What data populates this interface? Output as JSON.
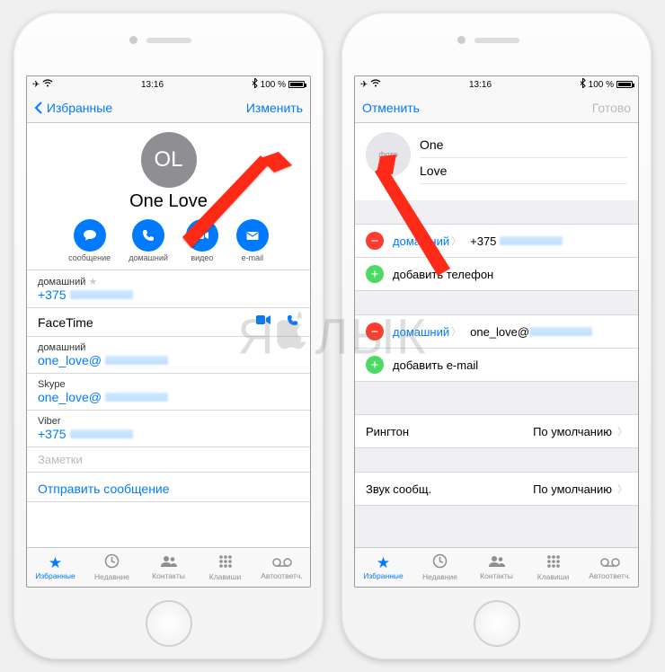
{
  "status": {
    "time": "13:16",
    "battery": "100 %",
    "bt_icon": "bt",
    "wifi_icon": "wifi",
    "plane_icon": "plane"
  },
  "left": {
    "nav": {
      "back": "Избранные",
      "edit": "Изменить"
    },
    "contact": {
      "initials": "OL",
      "name": "One Love"
    },
    "actions": [
      {
        "key": "message",
        "label": "сообщение",
        "icon": "message"
      },
      {
        "key": "home",
        "label": "домашний",
        "icon": "call"
      },
      {
        "key": "video",
        "label": "видео",
        "icon": "video"
      },
      {
        "key": "email",
        "label": "e-mail",
        "icon": "mail"
      }
    ],
    "rows": {
      "home_label": "домашний",
      "home_value": "+375",
      "facetime_label": "FaceTime",
      "email_label": "домашний",
      "email_value": "one_love@",
      "skype_label": "Skype",
      "skype_value": "one_love@",
      "viber_label": "Viber",
      "viber_value": "+375",
      "notes_label": "Заметки",
      "send_message": "Отправить сообщение"
    }
  },
  "right": {
    "nav": {
      "cancel": "Отменить",
      "done": "Готово"
    },
    "photo_label": "фото",
    "first_name": "One",
    "last_name": "Love",
    "phone": {
      "field_label": "домашний",
      "value": "+375",
      "add_label": "добавить телефон"
    },
    "email": {
      "field_label": "домашний",
      "value": "one_love@",
      "add_label": "добавить e-mail"
    },
    "ringtone": {
      "label": "Рингтон",
      "value": "По умолчанию"
    },
    "textTone": {
      "label": "Звук сообщ.",
      "value": "По умолчанию"
    }
  },
  "tabs": [
    {
      "key": "fav",
      "label": "Избранные",
      "icon": "★"
    },
    {
      "key": "recent",
      "label": "Недавние",
      "icon": "clock"
    },
    {
      "key": "contacts",
      "label": "Контакты",
      "icon": "people"
    },
    {
      "key": "keypad",
      "label": "Клавиши",
      "icon": "keypad"
    },
    {
      "key": "vm",
      "label": "Автоответч.",
      "icon": "vm"
    }
  ],
  "watermark": "ЯБЛЫК"
}
